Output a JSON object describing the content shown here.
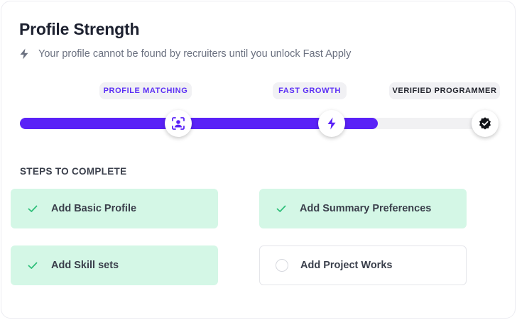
{
  "header": {
    "title": "Profile Strength",
    "subtitle": "Your profile cannot be found by recruiters until you unlock Fast Apply",
    "subtitle_icon": "lightning-icon"
  },
  "progress": {
    "completed_fraction": 0.75,
    "fill_color": "#5a22f7",
    "milestones": [
      {
        "label": "PROFILE MATCHING",
        "icon": "profile-scan-icon",
        "reached": true
      },
      {
        "label": "FAST GROWTH",
        "icon": "lightning-icon",
        "reached": true
      },
      {
        "label": "VERIFIED PROGRAMMER",
        "icon": "verified-badge-icon",
        "reached": false
      }
    ]
  },
  "steps": {
    "heading": "STEPS TO COMPLETE",
    "items": [
      {
        "label": "Add Basic Profile",
        "completed": true
      },
      {
        "label": "Add Summary Preferences",
        "completed": true
      },
      {
        "label": "Add Skill sets",
        "completed": true
      },
      {
        "label": "Add Project Works",
        "completed": false
      }
    ]
  },
  "colors": {
    "accent": "#5a22f7",
    "done_bg": "#d4f7e6",
    "check": "#2fbf7a"
  }
}
